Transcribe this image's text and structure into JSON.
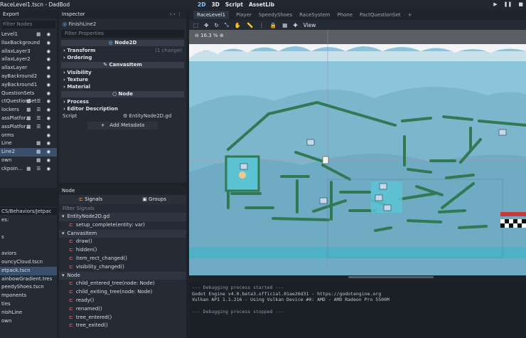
{
  "window": {
    "title": "RaceLevel1.tscn - DadBod",
    "modes": [
      "2D",
      "3D",
      "Script",
      "AssetLib"
    ]
  },
  "scene_dock": {
    "tab": "Export",
    "filter_placeholder": "Filter Nodes",
    "nodes": [
      {
        "label": "Level1",
        "icons": "▦ ◉"
      },
      {
        "label": "llaxBackground",
        "icons": "◉"
      },
      {
        "label": "allaxLayer3",
        "icons": "◉"
      },
      {
        "label": "allaxLayer2",
        "icons": "◉"
      },
      {
        "label": "allaxLayer",
        "icons": "◉"
      },
      {
        "label": "ayBackround2",
        "icons": "◉"
      },
      {
        "label": "ayBackround1",
        "icons": "◉"
      },
      {
        "label": "QuestionSets",
        "icons": "◉"
      },
      {
        "label": "ctQuestionSet",
        "icons": "▦ ☰ ◉"
      },
      {
        "label": "lockers",
        "icons": "▦ ☰ ◉"
      },
      {
        "label": "assPlatfor…",
        "icons": "▦ ☰ ◉"
      },
      {
        "label": "assPlatfor…",
        "icons": "▦ ☰ ◉"
      },
      {
        "label": "orms",
        "icons": "◉"
      },
      {
        "label": "Line",
        "icons": "▦ ◉"
      },
      {
        "label": "Line2",
        "icons": "▦ ◉",
        "selected": true
      },
      {
        "label": "own",
        "icons": "▦ ◉"
      },
      {
        "label": "ckpoin…",
        "icons": "▦ ☰ ◉"
      }
    ]
  },
  "file_dock": {
    "path": "CS/Behaviors/Jetpac",
    "items": [
      {
        "label": "es:"
      },
      {
        "label": ""
      },
      {
        "label": "s"
      },
      {
        "label": ""
      },
      {
        "label": "aviors"
      },
      {
        "label": "ouncyCloud.tscn"
      },
      {
        "label": "etpack.tscn",
        "selected": true
      },
      {
        "label": "ainbowGradient.tres"
      },
      {
        "label": "peedyShoes.tscn"
      },
      {
        "label": "mponents"
      },
      {
        "label": "ties"
      },
      {
        "label": "nishLine"
      },
      {
        "label": "own"
      }
    ]
  },
  "inspector": {
    "tab": "Inspector",
    "node_name": "FinishLine2",
    "filter_placeholder": "Filter Properties",
    "node2d_header": "Node2D",
    "node2d_props": [
      {
        "label": "Transform",
        "note": "(1 change)"
      },
      {
        "label": "Ordering",
        "note": ""
      }
    ],
    "canvasitem_header": "CanvasItem",
    "canvasitem_props": [
      {
        "label": "Visibility"
      },
      {
        "label": "Texture"
      },
      {
        "label": "Material"
      }
    ],
    "node_header": "Node",
    "node_props": [
      {
        "label": "Process"
      },
      {
        "label": "Editor Description"
      }
    ],
    "script_label": "Script",
    "script_value": "EntityNode2D.gd",
    "add_metadata": "Add Metadata"
  },
  "node_dock": {
    "tab": "Node",
    "signals_tab": "Signals",
    "groups_tab": "Groups",
    "filter_placeholder": "Filter Signals",
    "rows": [
      {
        "label": "EntityNode2D.gd",
        "kind": "head"
      },
      {
        "label": "setup_complete(entity: var)",
        "kind": "sig"
      },
      {
        "label": "CanvasItem",
        "kind": "head"
      },
      {
        "label": "draw()",
        "kind": "sig"
      },
      {
        "label": "hidden()",
        "kind": "sig"
      },
      {
        "label": "item_rect_changed()",
        "kind": "sig"
      },
      {
        "label": "visibility_changed()",
        "kind": "sig"
      },
      {
        "label": "Node",
        "kind": "head"
      },
      {
        "label": "child_entered_tree(node: Node)",
        "kind": "sig"
      },
      {
        "label": "child_exiting_tree(node: Node)",
        "kind": "sig"
      },
      {
        "label": "ready()",
        "kind": "sig"
      },
      {
        "label": "renamed()",
        "kind": "sig"
      },
      {
        "label": "tree_entered()",
        "kind": "sig"
      },
      {
        "label": "tree_exited()",
        "kind": "sig"
      }
    ]
  },
  "viewport": {
    "tabs": [
      "RaceLevel1",
      "Player",
      "SpeedyShoes",
      "RaceSystem",
      "Phone",
      "PactQuestionSet"
    ],
    "view_label": "View",
    "zoom": "16.3 %"
  },
  "output": {
    "lines": [
      "--- Debugging process started ---",
      "Godot Engine v4.0.beta3.official.01ae26d31 - https://godotengine.org",
      "Vulkan API 1.1.216 - Using Vulkan Device #0: AMD - AMD Radeon Pro 5500M",
      "",
      "--- Debugging process stopped ---"
    ]
  },
  "colors": {
    "accent": "#8ec7ff",
    "sky": "#8cc5db",
    "platform": "#2f7a55",
    "signal_icon": "#ff6b6b"
  }
}
